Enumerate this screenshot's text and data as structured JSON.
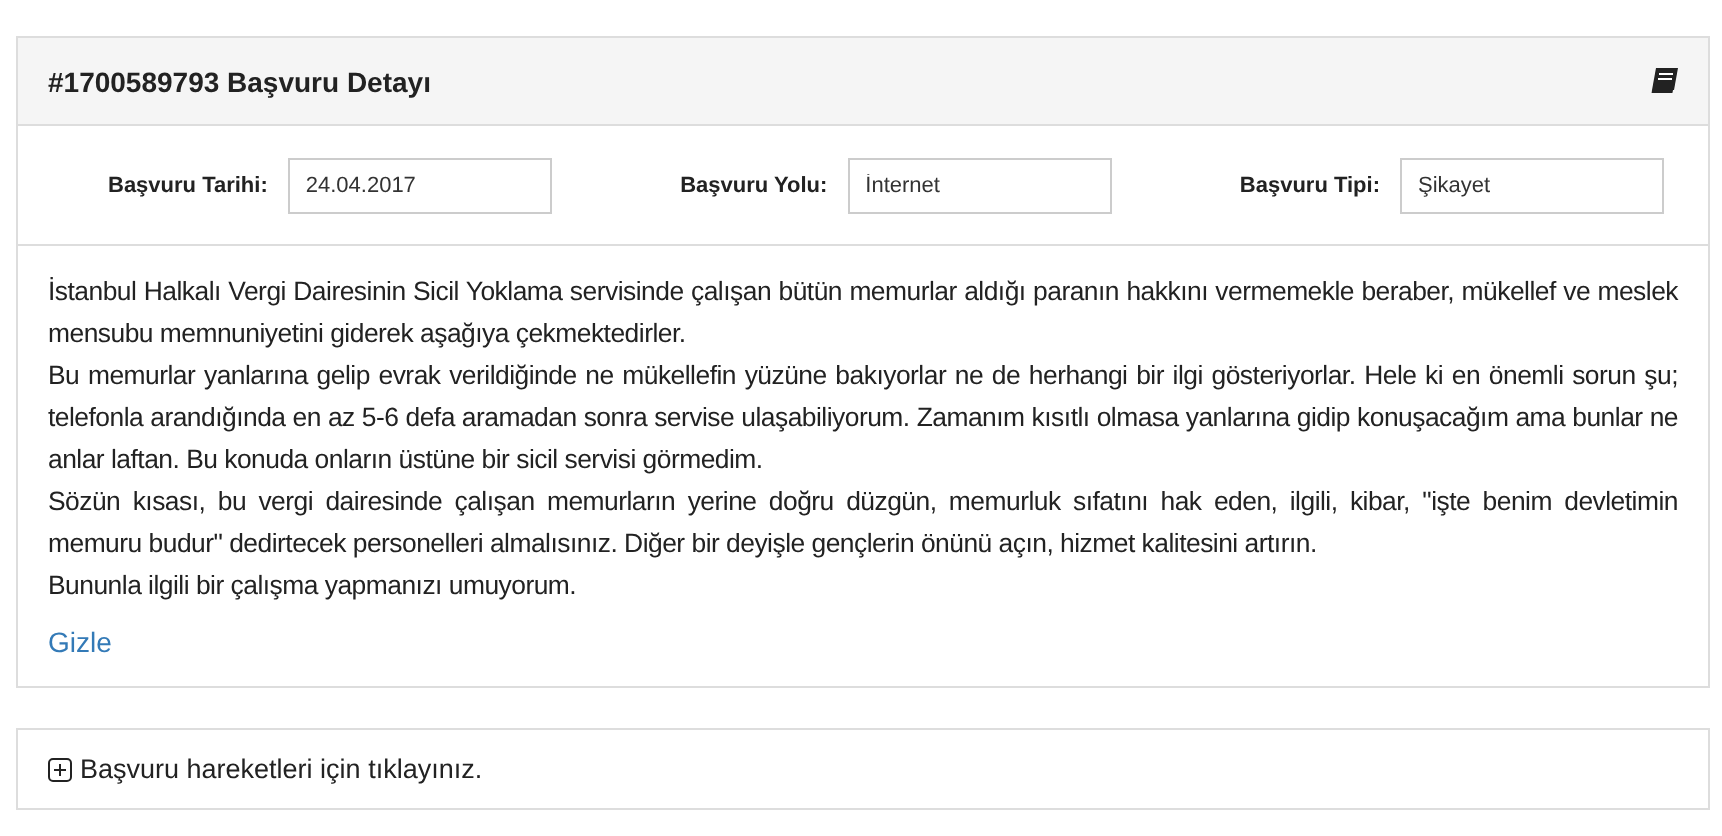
{
  "panel": {
    "title": "#1700589793 Başvuru Detayı",
    "fields": [
      {
        "label": "Başvuru Tarihi:",
        "value": "24.04.2017"
      },
      {
        "label": "Başvuru Yolu:",
        "value": "İnternet"
      },
      {
        "label": "Başvuru Tipi:",
        "value": "Şikayet"
      }
    ],
    "paragraphs": [
      "İstanbul Halkalı Vergi Dairesinin Sicil Yoklama servisinde çalışan bütün memurlar aldığı paranın hakkını vermemekle beraber, mükellef ve meslek mensubu memnuniyetini giderek aşağıya çekmektedirler.",
      "Bu memurlar yanlarına gelip evrak verildiğinde ne mükellefin yüzüne bakıyorlar ne de herhangi bir ilgi gösteriyorlar. Hele ki en önemli sorun şu; telefonla arandığında en az 5-6 defa aramadan sonra servise ulaşabiliyorum. Zamanım kısıtlı olmasa yanlarına gidip konuşacağım ama bunlar ne anlar laftan. Bu konuda onların üstüne bir sicil servisi görmedim.",
      "Sözün kısası, bu vergi dairesinde çalışan memurların yerine doğru düzgün, memurluk sıfatını hak eden, ilgili, kibar, \"işte benim devletimin memuru budur\" dedirtecek personelleri almalısınız. Diğer bir deyişle gençlerin önünü açın, hizmet kalitesini artırın.",
      "Bununla ilgili bir çalışma yapmanızı umuyorum."
    ],
    "hide_link": "Gizle"
  },
  "history": {
    "label": "Başvuru hareketleri için tıklayınız.",
    "expanded": false
  }
}
